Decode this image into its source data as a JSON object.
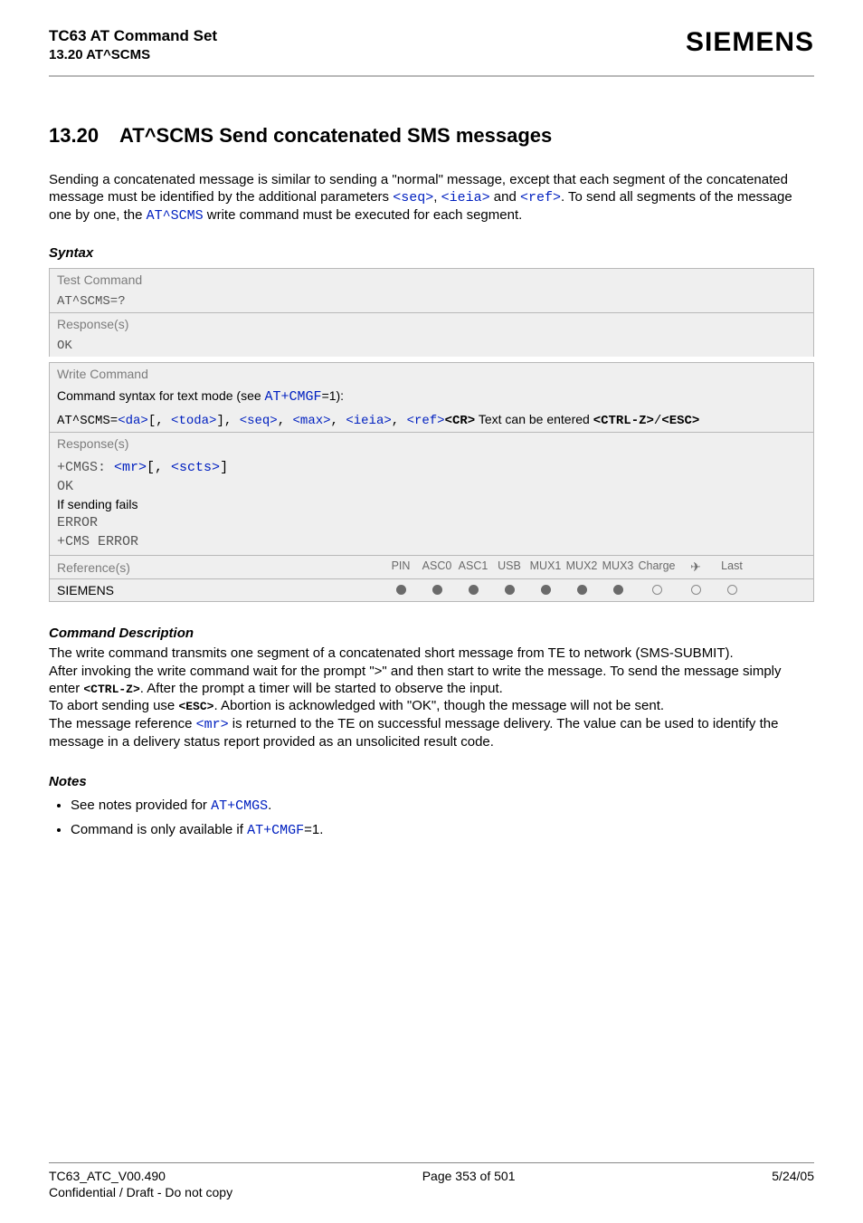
{
  "header": {
    "title": "TC63 AT Command Set",
    "subtitle": "13.20 AT^SCMS",
    "brand": "SIEMENS"
  },
  "section": {
    "number": "13.20",
    "title": "AT^SCMS   Send concatenated SMS messages"
  },
  "intro": {
    "p1a": "Sending a concatenated message is similar to sending a \"normal\" message, except that each segment of the concatenated message must be identified by the additional parameters ",
    "seq": "<seq>",
    "c1": ", ",
    "ieia": "<ieia>",
    "c2": " and ",
    "ref": "<ref>",
    "p1b": ". To send all segments of the message one by one, the ",
    "scms": "AT^SCMS",
    "p1c": " write command must be executed for each segment."
  },
  "syntax_label": "Syntax",
  "test_cmd": {
    "label": "Test Command",
    "cmd": "AT^SCMS=?",
    "resp_label": "Response(s)",
    "resp": "OK"
  },
  "write_cmd": {
    "label": "Write Command",
    "line_a": "Command syntax for text mode (see ",
    "cmgf": "AT+CMGF",
    "line_b": "=1):",
    "l2_a": "AT^SCMS=",
    "da": "<da>",
    "opt_open": "[, ",
    "toda": "<toda>",
    "opt_close": "], ",
    "seq": "<seq>",
    "c1": ", ",
    "max": "<max>",
    "c2": ", ",
    "ieia": "<ieia>",
    "c3": ", ",
    "ref": "<ref>",
    "cr": "<CR>",
    "txt": " Text can be entered ",
    "ctrlz": "<CTRL-Z>",
    "slash": "/",
    "esc": "<ESC>",
    "resp_label": "Response(s)",
    "r1_a": "+CMGS: ",
    "mr": "<mr>",
    "r1_b": "[, ",
    "scts": "<scts>",
    "r1_c": "]",
    "r2": "OK",
    "r3": "If sending fails",
    "r4": "ERROR",
    "r5": "+CMS ERROR"
  },
  "refs": {
    "label": "Reference(s)",
    "name": "SIEMENS",
    "cols": [
      "PIN",
      "ASC0",
      "ASC1",
      "USB",
      "MUX1",
      "MUX2",
      "MUX3",
      "Charge",
      "✈",
      "Last"
    ],
    "dots": [
      "f",
      "f",
      "f",
      "f",
      "f",
      "f",
      "f",
      "o",
      "o",
      "o"
    ]
  },
  "cmd_desc": {
    "label": "Command Description",
    "p1": "The write command transmits one segment of a concatenated short message from TE to network (SMS-SUBMIT).",
    "p2a": "After invoking the write command wait for the prompt \">\" and then start to write the message. To send the message simply enter ",
    "ctrlz": "<CTRL-Z>",
    "p2b": ". After the prompt a timer will be started to observe the input.",
    "p3a": "To abort sending use ",
    "esc": "<ESC>",
    "p3b": ". Abortion is acknowledged with \"OK\", though the message will not be sent.",
    "p4a": "The message reference ",
    "mr": "<mr>",
    "p4b": " is returned to the TE on successful message delivery. The value can be used to identify the message in a delivery status report provided as an unsolicited result code."
  },
  "notes": {
    "label": "Notes",
    "n1a": "See notes provided for ",
    "cmgs": "AT+CMGS",
    "n1b": ".",
    "n2a": "Command is only available if ",
    "cmgf": "AT+CMGF",
    "n2b": "=1."
  },
  "footer": {
    "left": "TC63_ATC_V00.490",
    "center": "Page 353 of 501",
    "right": "5/24/05",
    "sub": "Confidential / Draft - Do not copy"
  }
}
